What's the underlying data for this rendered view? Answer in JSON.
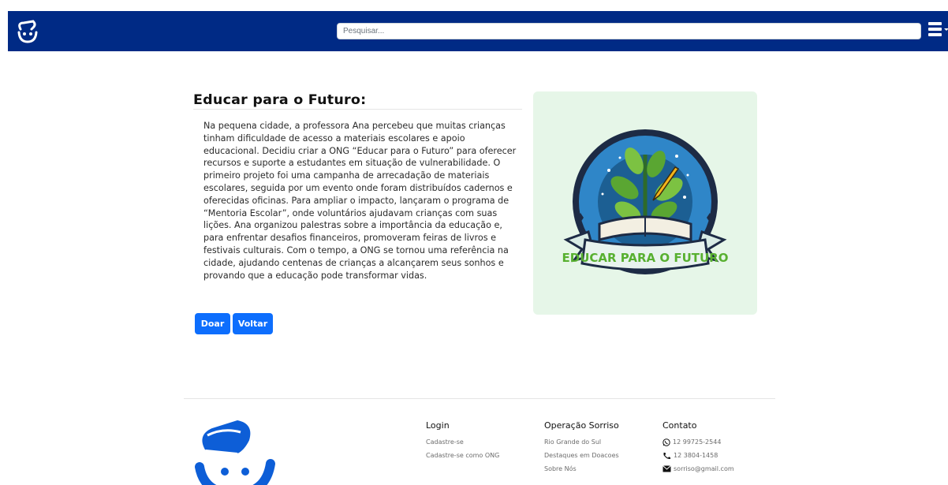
{
  "header": {
    "search_placeholder": "Pesquisar..."
  },
  "article": {
    "title": "Educar para o Futuro:",
    "body": "Na pequena cidade, a professora Ana percebeu que muitas crianças tinham dificuldade de acesso a materiais escolares e apoio educacional. Decidiu criar a ONG “Educar para o Futuro” para oferecer recursos e suporte a estudantes em situação de vulnerabilidade. O primeiro projeto foi uma campanha de arrecadação de materiais escolares, seguida por um evento onde foram distribuídos cadernos e oferecidas oficinas. Para ampliar o impacto, lançaram o programa de “Mentoria Escolar”, onde voluntários ajudavam crianças com suas lições. Ana organizou palestras sobre a importância da educação e, para enfrentar desafios financeiros, promoveram feiras de livros e festivais culturais. Com o tempo, a ONG se tornou uma referência na cidade, ajudando centenas de crianças a alcançarem seus sonhos e provando que a educação pode transformar vidas.",
    "donate_label": "Doar",
    "back_label": "Voltar",
    "image_banner_text": "EDUCAR PARA O FUTURO"
  },
  "footer": {
    "login": {
      "heading": "Login",
      "links": [
        "Cadastre-se",
        "Cadastre-se como ONG"
      ]
    },
    "operation": {
      "heading": "Operação Sorriso",
      "links": [
        "Rio Grande do Sul",
        "Destaques em Doacoes",
        "Sobre Nós"
      ]
    },
    "contact": {
      "heading": "Contato",
      "whatsapp": "12 99725-2544",
      "phone": "12 3804-1458",
      "email": "sorriso@gmail.com"
    }
  },
  "colors": {
    "navbar": "#002a85",
    "primary_button": "#0d6efd",
    "image_background": "#e6f6e8"
  }
}
